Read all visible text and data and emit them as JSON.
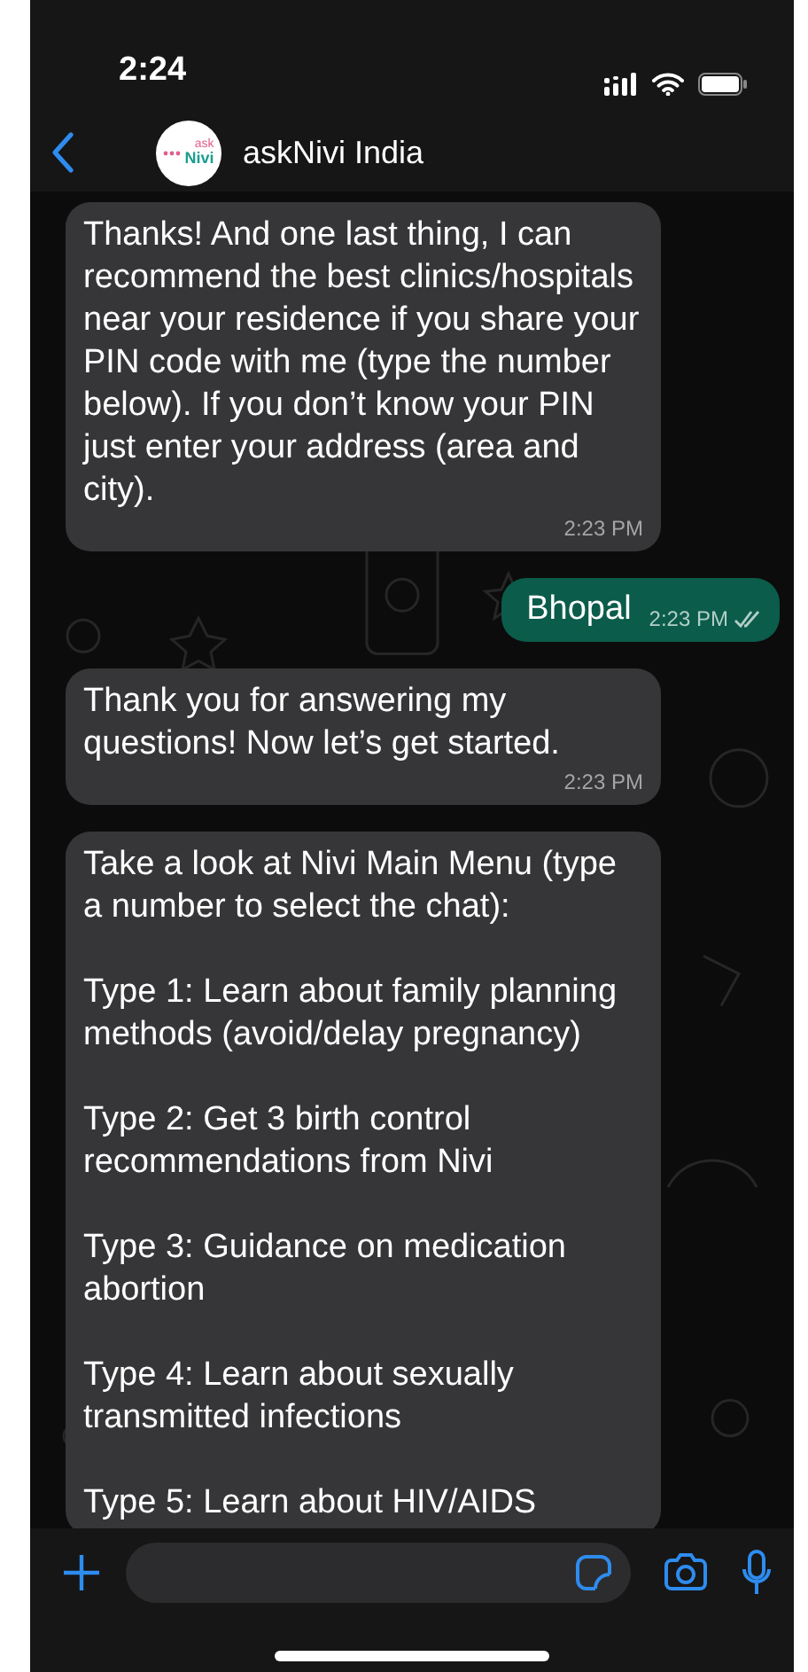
{
  "status_bar": {
    "time": "2:24"
  },
  "header": {
    "avatar": {
      "line_1": "ask",
      "line_2": "Nivi"
    },
    "title": "askNivi India"
  },
  "messages": [
    {
      "kind": "incoming",
      "paragraphs": [
        "Thanks! And one last thing, I can recommend the best clinics/hospitals near your residence if you share your PIN code with me (type the number below). If you don’t know your PIN just enter your address (area and city)."
      ],
      "time": "2:23 PM"
    },
    {
      "kind": "outgoing",
      "paragraphs": [
        "Bhopal"
      ],
      "time": "2:23 PM",
      "delivered": true
    },
    {
      "kind": "incoming",
      "paragraphs": [
        "Thank you for answering my questions! Now let’s get started."
      ],
      "time": "2:23 PM"
    },
    {
      "kind": "incoming",
      "paragraphs": [
        "Take a look at Nivi Main Menu (type a number to select the chat):",
        "Type 1: Learn about family planning methods (avoid/delay pregnancy)",
        "Type 2: Get 3 birth control recommendations from Nivi",
        "Type 3: Guidance on medication abortion",
        "Type 4: Learn about sexually transmitted infections",
        "Type 5: Learn about HIV/AIDS"
      ]
    }
  ]
}
